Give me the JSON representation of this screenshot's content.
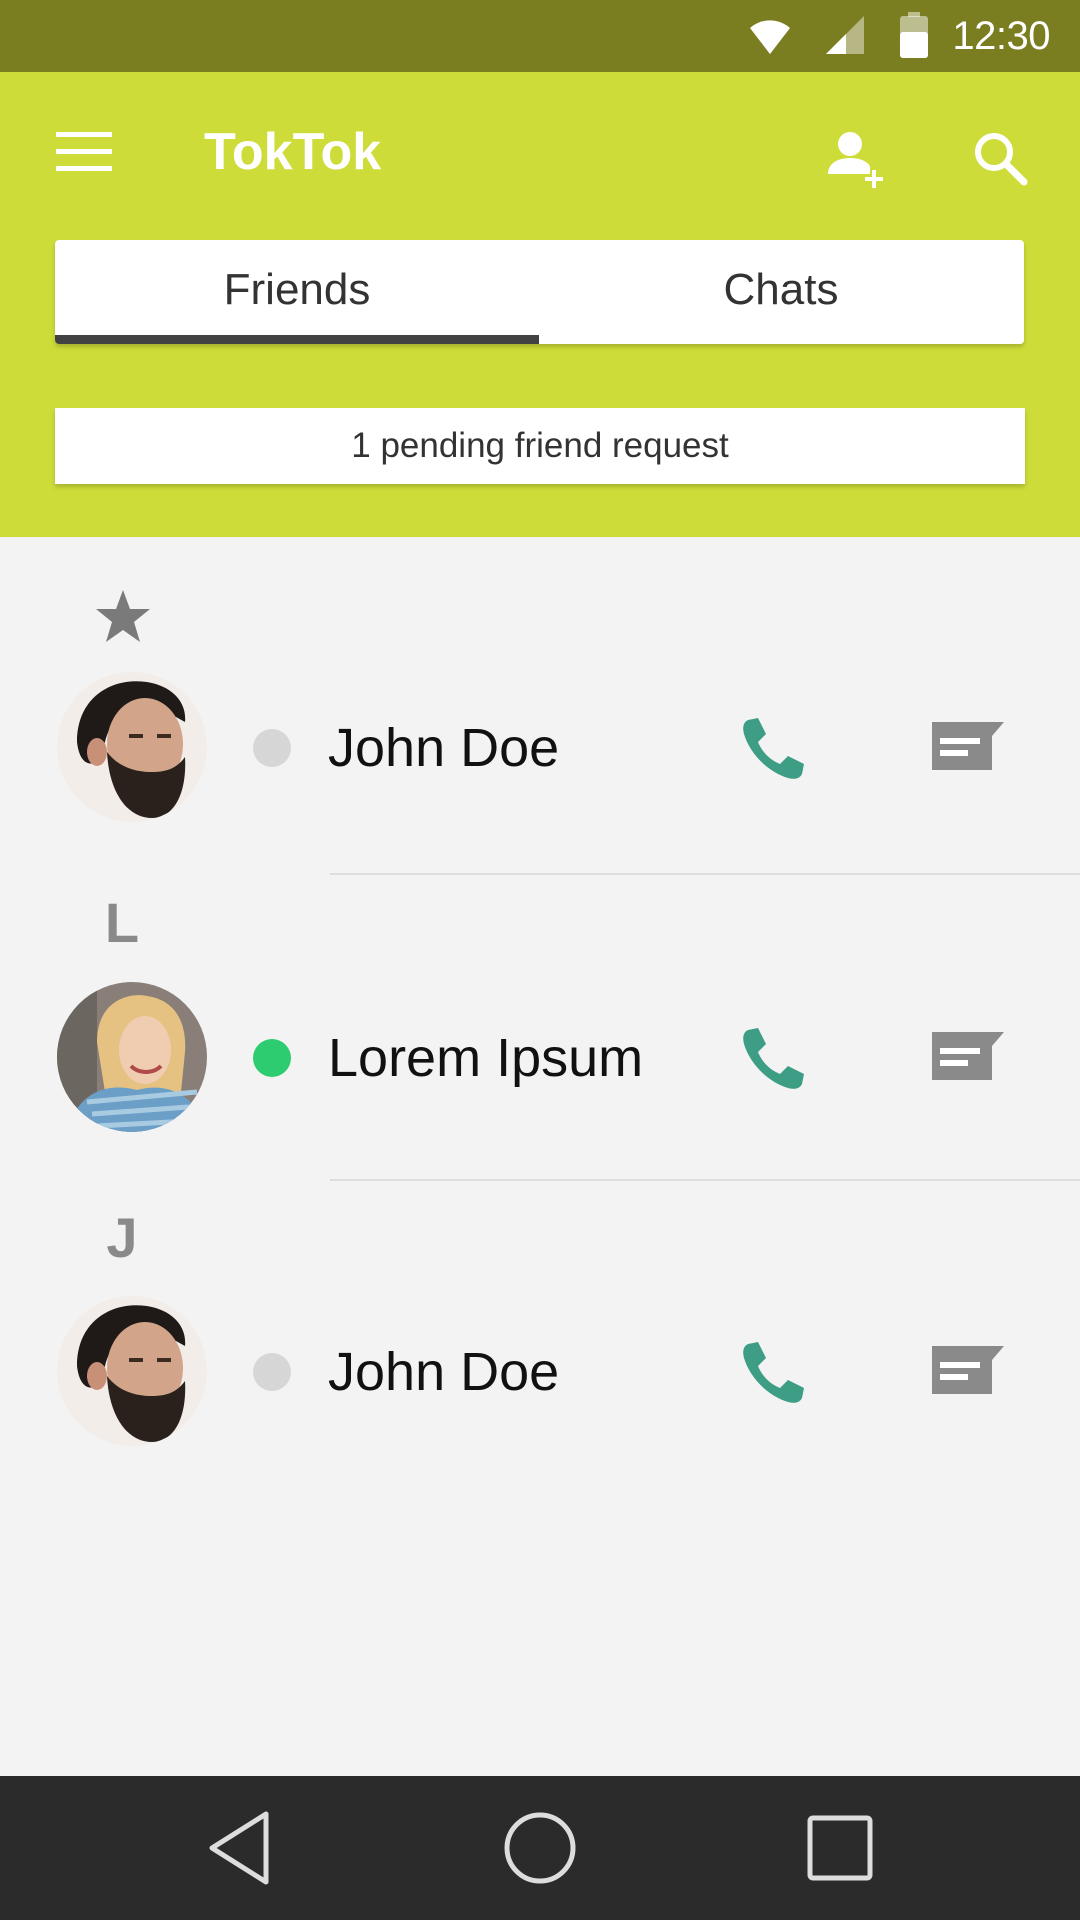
{
  "status_bar": {
    "time": "12:30",
    "icons": [
      "wifi-icon",
      "cellular-signal-icon",
      "battery-icon"
    ]
  },
  "app_bar": {
    "title": "TokTok",
    "icons": [
      "menu-icon",
      "add-user-icon",
      "search-icon"
    ],
    "background_color": "#cddc39"
  },
  "tabs": [
    {
      "label": "Friends",
      "selected": true
    },
    {
      "label": "Chats",
      "selected": false
    }
  ],
  "pending_banner": {
    "text": "1 pending friend request"
  },
  "sections": [
    {
      "header": "",
      "header_icon": "star-icon",
      "contacts": [
        {
          "name": "John Doe",
          "status": "offline",
          "status_color": "#d6d6d6"
        }
      ]
    },
    {
      "header": "L",
      "contacts": [
        {
          "name": "Lorem Ipsum",
          "status": "online",
          "status_color": "#2ecc71"
        }
      ]
    },
    {
      "header": "J",
      "contacts": [
        {
          "name": "John Doe",
          "status": "offline",
          "status_color": "#d6d6d6"
        }
      ]
    }
  ],
  "action_icons": [
    "phone-icon",
    "message-icon"
  ],
  "colors": {
    "status_bar": "#7a7d20",
    "accent": "#cddc39",
    "call": "#3e9e85",
    "message": "#8a8a8a"
  },
  "nav_bar": {
    "icons": [
      "back-icon",
      "home-icon",
      "recents-icon"
    ]
  }
}
